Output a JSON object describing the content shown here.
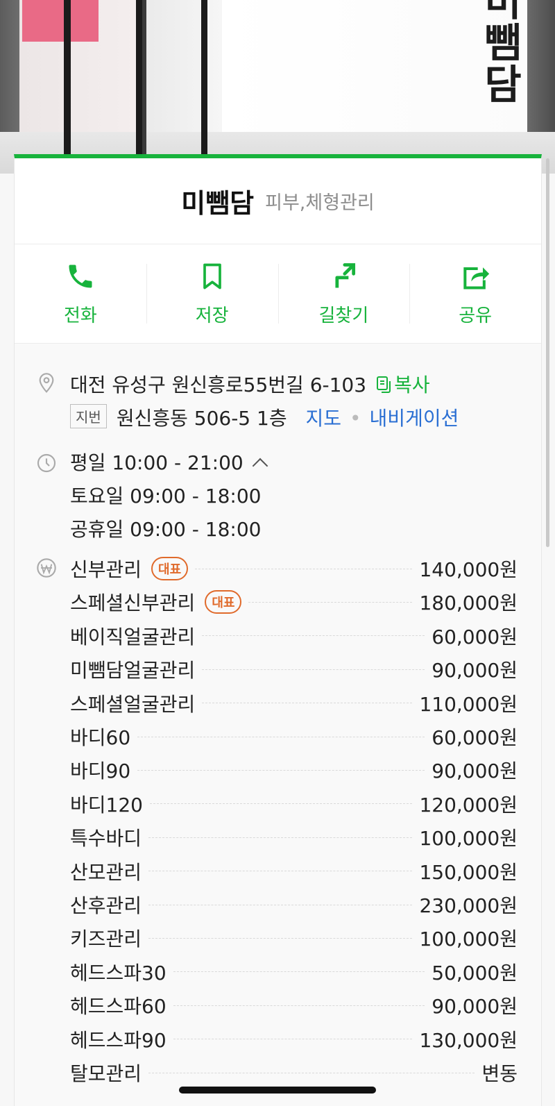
{
  "hero": {
    "sign_chars": [
      "미",
      "뺌",
      "담"
    ]
  },
  "place": {
    "name": "미뺌담",
    "category": "피부,체형관리"
  },
  "actions": [
    {
      "icon": "phone-icon",
      "label": "전화"
    },
    {
      "icon": "bookmark-icon",
      "label": "저장"
    },
    {
      "icon": "directions-icon",
      "label": "길찾기"
    },
    {
      "icon": "share-icon",
      "label": "공유"
    }
  ],
  "address": {
    "road": "대전 유성구 원신흥로55번길 6-103",
    "copy_label": "복사",
    "jibun_badge": "지번",
    "jibun": "원신흥동 506-5 1층",
    "map_link": "지도",
    "nav_link": "내비게이션"
  },
  "hours": {
    "weekday": "평일 10:00 - 21:00",
    "saturday": "토요일 09:00 - 18:00",
    "holiday": "공휴일 09:00 - 18:00"
  },
  "prices": {
    "rep_badge": "대표",
    "items": [
      {
        "name": "신부관리",
        "price": "140,000원",
        "rep": true
      },
      {
        "name": "스페셜신부관리",
        "price": "180,000원",
        "rep": true
      },
      {
        "name": "베이직얼굴관리",
        "price": "60,000원"
      },
      {
        "name": "미뺌담얼굴관리",
        "price": "90,000원"
      },
      {
        "name": "스페셜얼굴관리",
        "price": "110,000원"
      },
      {
        "name": "바디60",
        "price": "60,000원"
      },
      {
        "name": "바디90",
        "price": "90,000원"
      },
      {
        "name": "바디120",
        "price": "120,000원"
      },
      {
        "name": "특수바디",
        "price": "100,000원"
      },
      {
        "name": "산모관리",
        "price": "150,000원"
      },
      {
        "name": "산후관리",
        "price": "230,000원"
      },
      {
        "name": "키즈관리",
        "price": "100,000원"
      },
      {
        "name": "헤드스파30",
        "price": "50,000원"
      },
      {
        "name": "헤드스파60",
        "price": "90,000원"
      },
      {
        "name": "헤드스파90",
        "price": "130,000원"
      },
      {
        "name": "탈모관리",
        "price": "변동"
      }
    ]
  },
  "colors": {
    "accent": "#17b33c",
    "link": "#2a6fd3",
    "badge": "#e06a2b"
  }
}
